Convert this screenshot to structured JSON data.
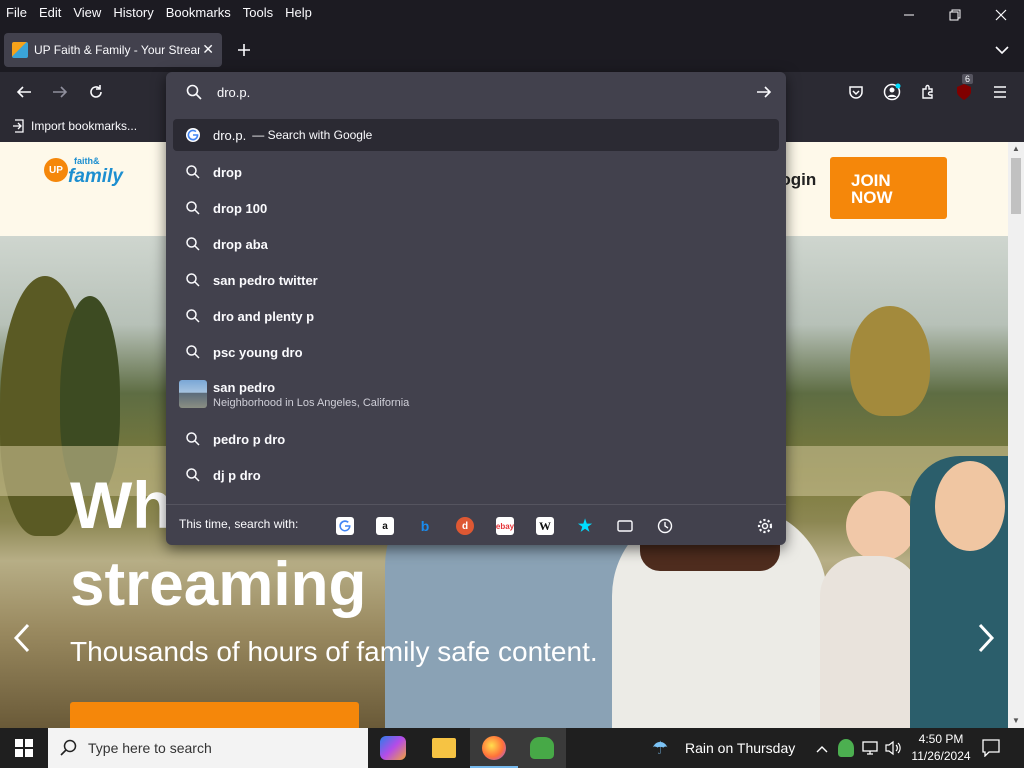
{
  "menubar": {
    "items": [
      "File",
      "Edit",
      "View",
      "History",
      "Bookmarks",
      "Tools",
      "Help"
    ]
  },
  "tab": {
    "title": "UP Faith & Family - Your Streaming"
  },
  "toolbar": {
    "badge_count": "6"
  },
  "urlbar": {
    "value": "dro.p."
  },
  "bookmarks": {
    "import_label": "Import bookmarks..."
  },
  "suggestions": {
    "first_query": "dro.p.",
    "first_action": "— Search with Google",
    "items": [
      "drop",
      "drop 100",
      "drop aba",
      "san pedro twitter",
      "dro and plenty p",
      "psc young dro"
    ],
    "place_title": "san pedro",
    "place_subtitle": "Neighborhood in Los Angeles, California",
    "items2": [
      "pedro p dro",
      "dj p dro"
    ],
    "search_with_label": "This time, search with:"
  },
  "site": {
    "logo_top": "faith&",
    "logo_main": "family",
    "logo_up": "UP",
    "login": "Login",
    "join_line1": "JOIN",
    "join_line2": "NOW",
    "hero_word1": "Wh",
    "hero_word2": "streaming",
    "hero_sub": "Thousands of hours of family safe content."
  },
  "taskbar": {
    "search_placeholder": "Type here to search",
    "weather": "Rain on Thursday",
    "time": "4:50 PM",
    "date": "11/26/2024"
  },
  "colors": {
    "accent_orange": "#f5870a",
    "browser_dark": "#1c1b22",
    "toolbar": "#2b2a33",
    "panel": "#42414d"
  }
}
